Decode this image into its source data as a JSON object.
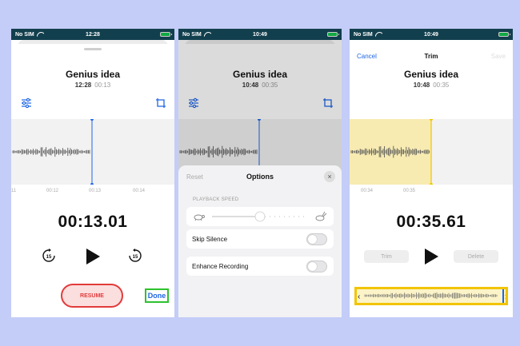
{
  "colors": {
    "accent": "#1f66e5",
    "record_red": "#e23b3b",
    "highlight_green": "#2ec22e",
    "trim_yellow": "#f2c400"
  },
  "screen1": {
    "status": {
      "carrier": "No SIM",
      "time": "12:28"
    },
    "title": "Genius idea",
    "time": "12:28",
    "duration": "00:13",
    "ticks": [
      "11",
      "00:12",
      "00:13",
      "00:14"
    ],
    "timer": "00:13.01",
    "resume_label": "RESUME",
    "done_label": "Done",
    "skip_back": "15",
    "skip_fwd": "15"
  },
  "screen2": {
    "status": {
      "carrier": "No SIM",
      "time": "10:49"
    },
    "title": "Genius idea",
    "time": "10:48",
    "duration": "00:35",
    "options": {
      "reset_label": "Reset",
      "title": "Options",
      "close_icon": "×",
      "section_label": "PLAYBACK SPEED",
      "skip_silence_label": "Skip Silence",
      "enhance_label": "Enhance Recording",
      "playback_speed": 0.5
    }
  },
  "screen3": {
    "status": {
      "carrier": "No SIM",
      "time": "10:49"
    },
    "cancel_label": "Cancel",
    "nav_title": "Trim",
    "save_label": "Save",
    "title": "Genius idea",
    "time": "10:48",
    "duration": "00:35",
    "ticks": [
      "00:34",
      "00:35"
    ],
    "timer": "00:35.61",
    "trim_label": "Trim",
    "delete_label": "Delete"
  }
}
